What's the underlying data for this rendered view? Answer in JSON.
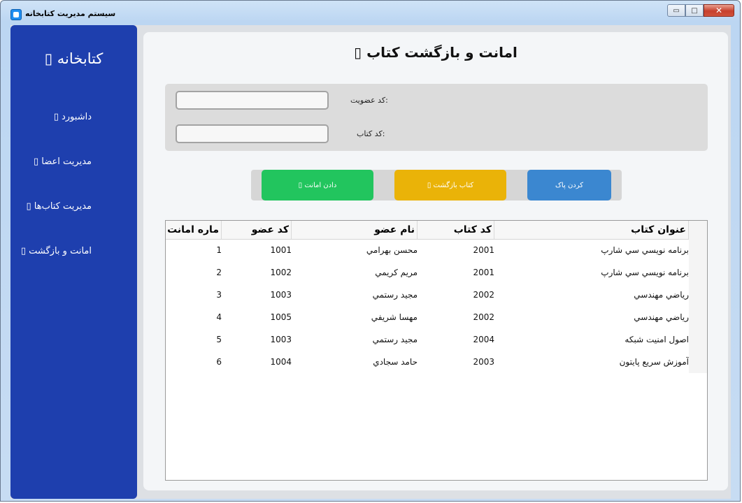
{
  "window": {
    "title": "سیستم مدیریت کتابخانه",
    "minimize": "▭",
    "maximize": "□",
    "close": "✕"
  },
  "sidebar": {
    "brand": "کتابخانه ▯",
    "items": [
      {
        "label": "داشبورد ▯"
      },
      {
        "label": "مدیریت اعضا ▯"
      },
      {
        "label": "مدیریت کتاب‌ها ▯"
      },
      {
        "label": "امانت و بازگشت ▯"
      }
    ],
    "bg_color": "#1e3fae"
  },
  "main": {
    "title": "امانت و بازگشت کتاب ▯",
    "form": {
      "member_label": ":کد عضویت",
      "member_value": "",
      "book_label": ":کد کتاب",
      "book_value": ""
    },
    "buttons": {
      "lend": "دادن امانت ▯",
      "return": "کتاب بازگشت ▯",
      "clear": "کردن پاک",
      "lend_color": "#22c55e",
      "return_color": "#eab308",
      "clear_color": "#3b87d0"
    },
    "table": {
      "columns": [
        "ماره امانت",
        "کد عضو",
        "نام عضو",
        "کد کتاب",
        "عنوان کتاب"
      ],
      "rows": [
        {
          "id": "1",
          "member_code": "1001",
          "member_name": "محسن بهرامي",
          "book_code": "2001",
          "book_title": "برنامه نويسي سي شارپ"
        },
        {
          "id": "2",
          "member_code": "1002",
          "member_name": "مريم کريمي",
          "book_code": "2001",
          "book_title": "برنامه نويسي سي شارپ"
        },
        {
          "id": "3",
          "member_code": "1003",
          "member_name": "مجيد رستمي",
          "book_code": "2002",
          "book_title": "رياضي مهندسي"
        },
        {
          "id": "4",
          "member_code": "1005",
          "member_name": "مهسا شريفي",
          "book_code": "2002",
          "book_title": "رياضي مهندسي"
        },
        {
          "id": "5",
          "member_code": "1003",
          "member_name": "مجيد رستمي",
          "book_code": "2004",
          "book_title": "اصول امنيت شبكه"
        },
        {
          "id": "6",
          "member_code": "1004",
          "member_name": "حامد سجادي",
          "book_code": "2003",
          "book_title": "آموزش سريع پايتون"
        }
      ]
    }
  }
}
